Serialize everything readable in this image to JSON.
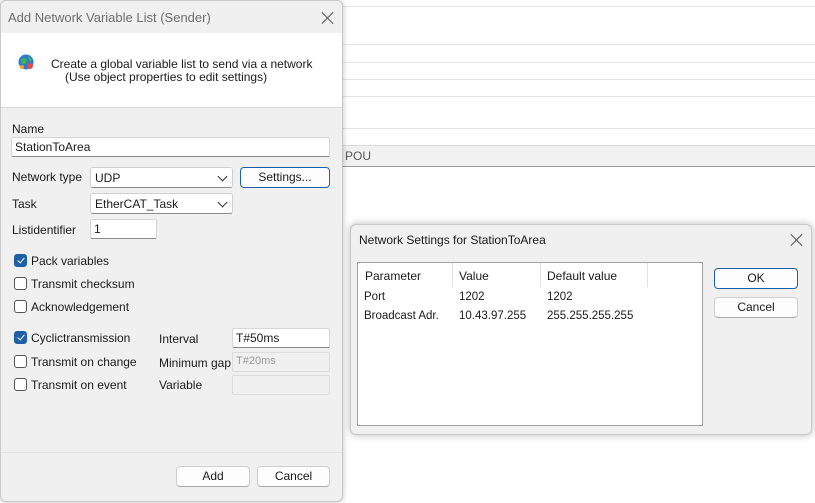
{
  "background": {
    "pou_label": "POU"
  },
  "main_dialog": {
    "title": "Add Network Variable List (Sender)",
    "header_line1": "Create a global variable list to send via a network",
    "header_line2": "(Use object properties to edit settings)",
    "name_label": "Name",
    "name_value": "StationToArea",
    "network_type_label": "Network type",
    "network_type_value": "UDP",
    "settings_button": "Settings...",
    "task_label": "Task",
    "task_value": "EtherCAT_Task",
    "listidentifier_label": "Listidentifier",
    "listidentifier_value": "1",
    "checkboxes": {
      "pack_variables": {
        "label": "Pack variables",
        "checked": true
      },
      "transmit_checksum": {
        "label": "Transmit checksum",
        "checked": false
      },
      "acknowledgement": {
        "label": "Acknowledgement",
        "checked": false
      },
      "cyclic_transmission": {
        "label": "Cyclictransmission",
        "checked": true
      },
      "transmit_on_change": {
        "label": "Transmit on change",
        "checked": false
      },
      "transmit_on_event": {
        "label": "Transmit on event",
        "checked": false
      }
    },
    "interval_label": "Interval",
    "interval_value": "T#50ms",
    "minimum_gap_label": "Minimum gap",
    "minimum_gap_value": "T#20ms",
    "variable_label": "Variable",
    "variable_value": "",
    "add_button": "Add",
    "cancel_button": "Cancel"
  },
  "network_dialog": {
    "title": "Network Settings for StationToArea",
    "columns": [
      "Parameter",
      "Value",
      "Default value"
    ],
    "rows": [
      [
        "Port",
        "1202",
        "1202"
      ],
      [
        "Broadcast Adr.",
        "10.43.97.255",
        "255.255.255.255"
      ]
    ],
    "ok_button": "OK",
    "cancel_button": "Cancel"
  },
  "colors": {
    "accent": "#1f5fa8",
    "dialog_bg": "#f0f0f0"
  },
  "icons": [
    "globe-network-icon",
    "close-icon",
    "chevron-down-icon",
    "checkmark-icon"
  ]
}
